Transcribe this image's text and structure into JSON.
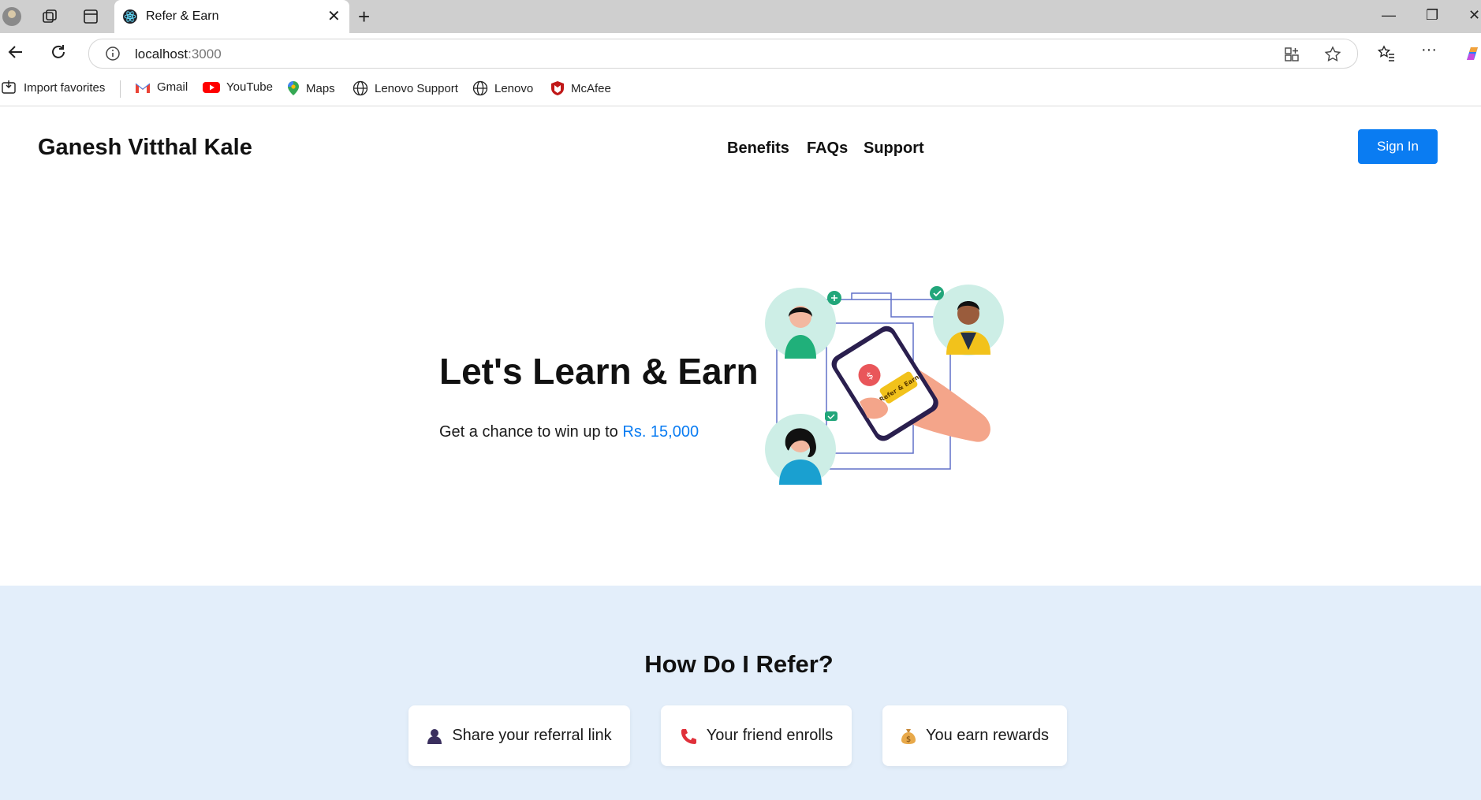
{
  "browser": {
    "tab_title": "Refer & Earn",
    "url_host": "localhost",
    "url_port": ":3000",
    "bookmarks": [
      "Import favorites",
      "Gmail",
      "YouTube",
      "Maps",
      "Lenovo Support",
      "Lenovo",
      "McAfee"
    ]
  },
  "header": {
    "brand": "Ganesh Vitthal Kale",
    "nav": [
      "Benefits",
      "FAQs",
      "Support"
    ],
    "signin_label": "Sign In"
  },
  "hero": {
    "title": "Let's Learn & Earn",
    "subtitle_prefix": "Get a chance to win up to ",
    "subtitle_amount": "Rs. 15,000",
    "illustration_badge": "Refer & Earn"
  },
  "how": {
    "title": "How Do I Refer?",
    "steps": [
      {
        "label": "Share your referral link",
        "icon": "person-icon"
      },
      {
        "label": "Your friend enrolls",
        "icon": "phone-icon"
      },
      {
        "label": "You earn rewards",
        "icon": "money-bag-icon"
      }
    ]
  },
  "colors": {
    "accent": "#0a7cf2",
    "band": "#e3eefa"
  }
}
